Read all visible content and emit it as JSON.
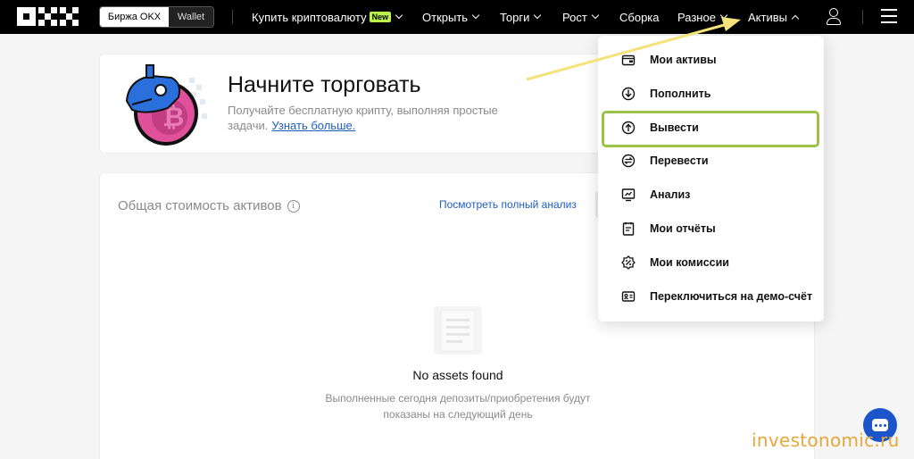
{
  "header": {
    "logo": "OKX",
    "switch": {
      "exchange": "Биржа OKX",
      "wallet": "Wallet"
    },
    "nav": [
      {
        "label": "Купить криптовалюту",
        "badge": "New",
        "chevron": "down"
      },
      {
        "label": "Открыть",
        "chevron": "down"
      },
      {
        "label": "Торги",
        "chevron": "down"
      },
      {
        "label": "Рост",
        "chevron": "down"
      },
      {
        "label": "Сборка",
        "chevron": "none"
      },
      {
        "label": "Разное",
        "chevron": "down"
      },
      {
        "label": "Активы",
        "chevron": "up"
      }
    ]
  },
  "promo": {
    "title": "Начните торговать",
    "description": "Получайте бесплатную крипту, выполняя простые задачи.",
    "link": "Узнать больше."
  },
  "assets": {
    "title": "Общая стоимость активов",
    "analysis_link": "Посмотреть полный анализ",
    "empty_title": "No assets found",
    "empty_description": "Выполненные сегодня депозиты/приобретения будут показаны на следующий день"
  },
  "dropdown": {
    "items": [
      {
        "label": "Мои активы",
        "icon": "wallet-icon"
      },
      {
        "label": "Пополнить",
        "icon": "deposit-icon"
      },
      {
        "label": "Вывести",
        "icon": "withdraw-icon"
      },
      {
        "label": "Перевести",
        "icon": "transfer-icon"
      },
      {
        "label": "Анализ",
        "icon": "analysis-icon"
      },
      {
        "label": "Мои отчёты",
        "icon": "report-icon"
      },
      {
        "label": "Мои комиссии",
        "icon": "commission-icon"
      },
      {
        "label": "Переключиться на демо-счёт",
        "icon": "demo-account-icon"
      }
    ],
    "highlighted": "Вывести"
  },
  "watermark": "investonomic.ru",
  "colors": {
    "header_bg": "#000000",
    "link": "#1d5fbf",
    "badge_new": "#b9f24b",
    "highlight_border": "#9cc349",
    "arrow": "#f5e27a",
    "chat_button": "#1b55c9",
    "watermark": "#e6a73a"
  }
}
